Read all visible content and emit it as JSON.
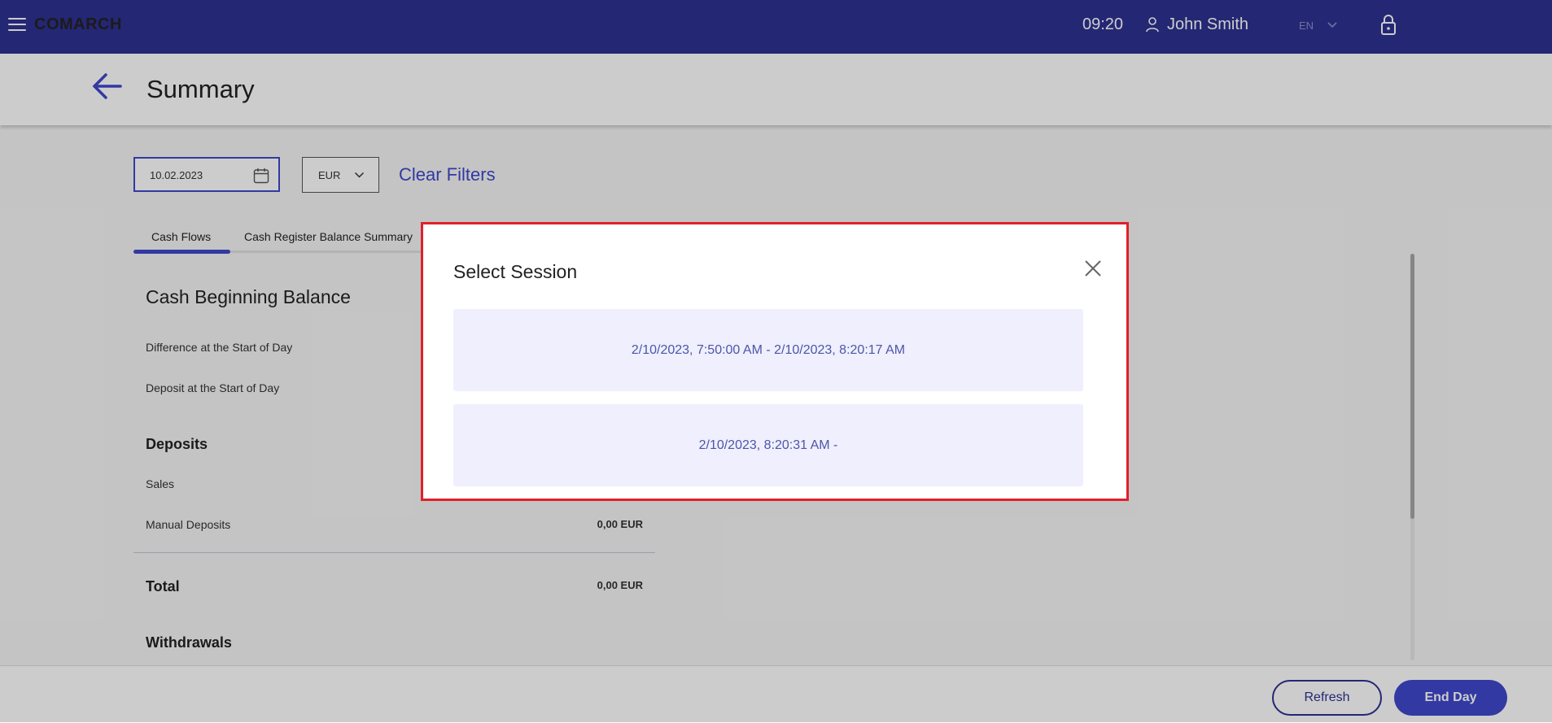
{
  "topbar": {
    "logo": "COMARCH",
    "time": "09:20",
    "user_name": "John Smith",
    "language": "EN",
    "color": "#2e3192"
  },
  "header": {
    "title": "Summary"
  },
  "filters": {
    "date": "10.02.2023",
    "currency": "EUR",
    "clear_label": "Clear Filters"
  },
  "tabs": [
    {
      "label": "Cash Flows",
      "active": true
    },
    {
      "label": "Cash Register Balance Summary",
      "active": false
    }
  ],
  "content": {
    "beginning_title": "Cash Beginning Balance",
    "difference_label": "Difference at the Start of Day",
    "deposit_start_label": "Deposit at the Start of Day",
    "deposits_title": "Deposits",
    "sales_label": "Sales",
    "manual_deposits_label": "Manual Deposits",
    "manual_deposits_value": "0,00 EUR",
    "total_label": "Total",
    "total_value": "0,00 EUR",
    "withdrawals_title": "Withdrawals"
  },
  "footer": {
    "refresh_label": "Refresh",
    "end_day_label": "End Day"
  },
  "modal": {
    "title": "Select Session",
    "sessions": [
      "2/10/2023, 7:50:00 AM - 2/10/2023, 8:20:17 AM",
      "2/10/2023, 8:20:31 AM -"
    ],
    "highlight_color": "#e0202a",
    "session_bg": "#efeffd"
  },
  "icons": {
    "menu": "hamburger-icon",
    "user": "user-icon",
    "chevron": "chevron-down-icon",
    "lock": "lock-icon",
    "back": "arrow-left-icon",
    "calendar": "calendar-icon",
    "close": "close-icon"
  }
}
